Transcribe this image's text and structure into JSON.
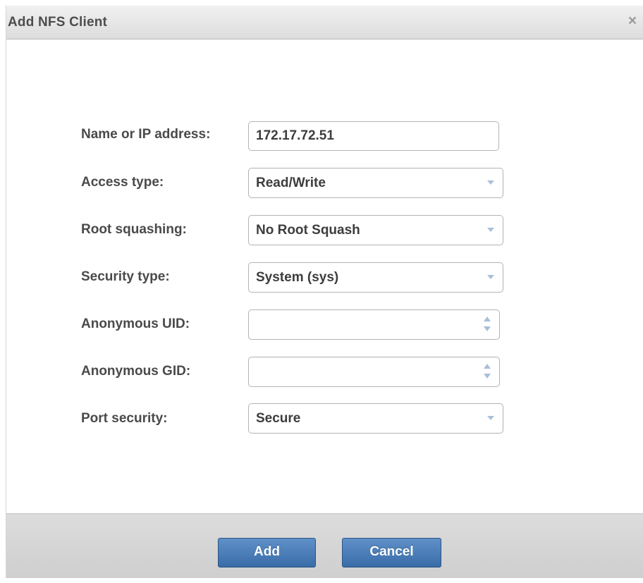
{
  "dialog": {
    "title": "Add NFS Client",
    "close_glyph": "×"
  },
  "form": {
    "name_or_ip": {
      "label": "Name or IP address:",
      "value": "172.17.72.51"
    },
    "access_type": {
      "label": "Access type:",
      "value": "Read/Write"
    },
    "root_squashing": {
      "label": "Root squashing:",
      "value": "No Root Squash"
    },
    "security_type": {
      "label": "Security type:",
      "value": "System (sys)"
    },
    "anonymous_uid": {
      "label": "Anonymous UID:",
      "value": ""
    },
    "anonymous_gid": {
      "label": "Anonymous GID:",
      "value": ""
    },
    "port_security": {
      "label": "Port security:",
      "value": "Secure"
    }
  },
  "footer": {
    "add_label": "Add",
    "cancel_label": "Cancel"
  },
  "colors": {
    "button_blue": "#4a7dba",
    "arrow_blue": "#a9bfd8",
    "label_gray": "#4a4a4a"
  },
  "icons": [
    "close-icon",
    "chevron-down-icon",
    "spin-up-icon",
    "spin-down-icon"
  ]
}
